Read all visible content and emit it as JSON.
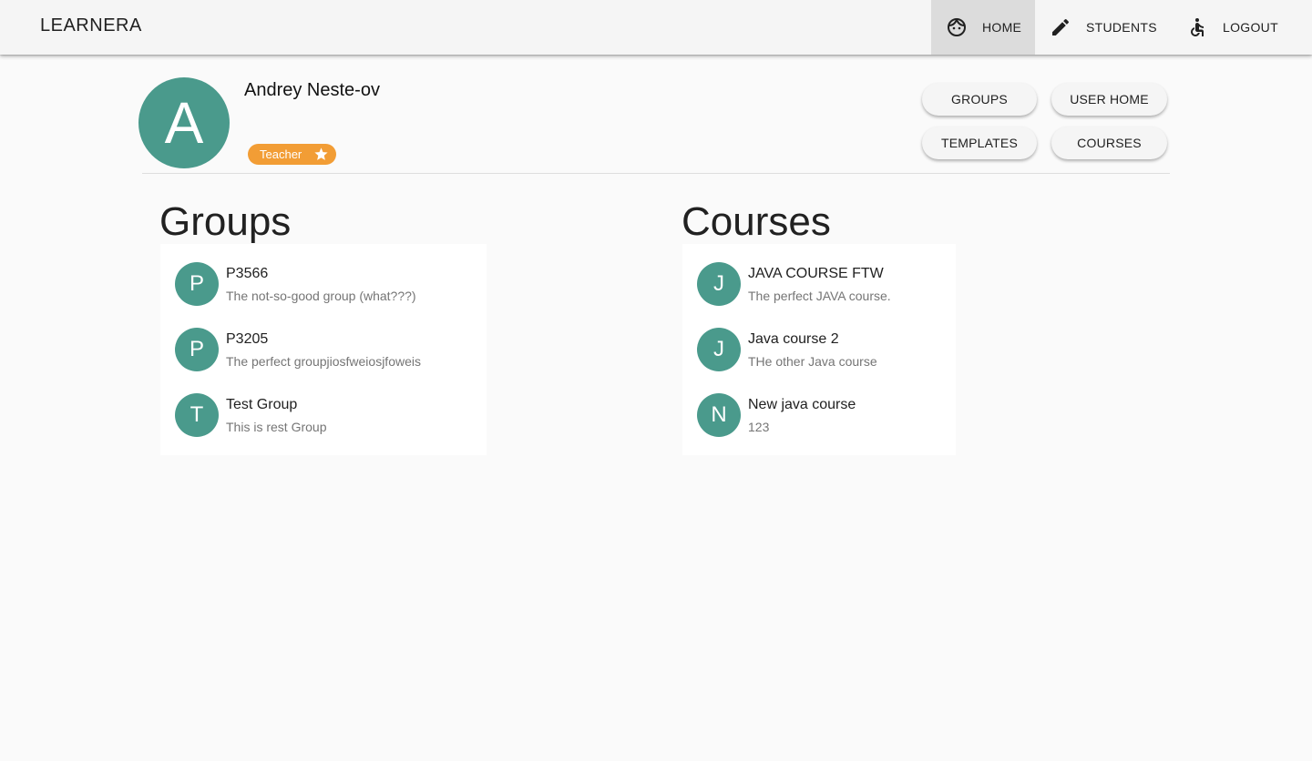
{
  "brand": "LEARNERA",
  "nav": {
    "home": {
      "label": "HOME",
      "icon": "face-icon"
    },
    "students": {
      "label": "STUDENTS",
      "icon": "pencil-icon"
    },
    "logout": {
      "label": "LOGOUT",
      "icon": "accessible-icon"
    },
    "active": "home"
  },
  "profile": {
    "initial": "A",
    "name": "Andrey Neste-ov",
    "role": "Teacher",
    "role_icon": "star-icon"
  },
  "actions": {
    "groups": "GROUPS",
    "user_home": "USER HOME",
    "templates": "TEMPLATES",
    "courses": "COURSES"
  },
  "groups": {
    "title": "Groups",
    "items": [
      {
        "initial": "P",
        "name": "P3566",
        "description": "The not-so-good group (what???)"
      },
      {
        "initial": "P",
        "name": "P3205",
        "description": "The perfect groupjiosfweiosjfoweis"
      },
      {
        "initial": "T",
        "name": "Test Group",
        "description": "This is rest Group"
      }
    ]
  },
  "courses": {
    "title": "Courses",
    "items": [
      {
        "initial": "J",
        "name": "JAVA COURSE FTW",
        "description": "The perfect JAVA course."
      },
      {
        "initial": "J",
        "name": "Java course 2",
        "description": "THe other Java course"
      },
      {
        "initial": "N",
        "name": "New java course",
        "description": "123"
      }
    ]
  },
  "colors": {
    "avatar": "#4a9a8c",
    "chip": "#f29d35",
    "topbar": "#f5f5f5",
    "active_nav": "#dcdcdc",
    "background": "#fafafa"
  }
}
